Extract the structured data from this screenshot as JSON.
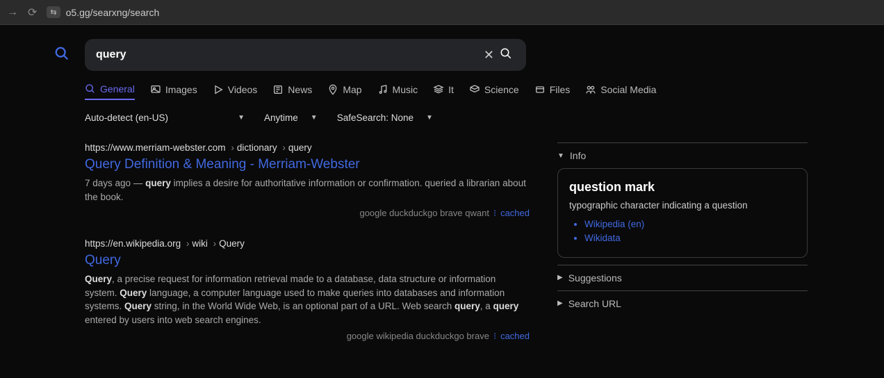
{
  "browser": {
    "url": "o5.gg/searxng/search"
  },
  "search": {
    "value": "query"
  },
  "tabs": {
    "general": "General",
    "images": "Images",
    "videos": "Videos",
    "news": "News",
    "map": "Map",
    "music": "Music",
    "it": "It",
    "science": "Science",
    "files": "Files",
    "social": "Social Media"
  },
  "filters": {
    "lang": "Auto-detect (en-US)",
    "time": "Anytime",
    "safe": "SafeSearch: None"
  },
  "results": [
    {
      "url_parts": [
        "https://www.merriam-webster.com",
        "dictionary",
        "query"
      ],
      "title": "Query Definition & Meaning - Merriam-Webster",
      "age": "7 days ago",
      "snippet_pre": " — ",
      "bold1": "query",
      "snippet": " implies a desire for authoritative information or confirmation. queried a librarian about the book.",
      "engines": "google  duckduckgo  brave  qwant",
      "cached": "cached"
    },
    {
      "url_parts": [
        "https://en.wikipedia.org",
        "wiki",
        "Query"
      ],
      "title": "Query",
      "snippet_html": "<b>Query</b>, a precise request for information retrieval made to a database, data structure or information system. <b>Query</b> language, a computer language used to make queries into databases and information systems. <b>Query</b> string, in the World Wide Web, is an optional part of a URL. Web search <b>query</b>, a <b>query</b> entered by users into web search engines.",
      "engines": "google  wikipedia  duckduckgo  brave",
      "cached": "cached"
    }
  ],
  "sidebar": {
    "info_label": "Info",
    "infobox": {
      "title": "question mark",
      "desc": "typographic character indicating a question",
      "links": [
        "Wikipedia (en)",
        "Wikidata"
      ]
    },
    "suggestions_label": "Suggestions",
    "searchurl_label": "Search URL"
  }
}
